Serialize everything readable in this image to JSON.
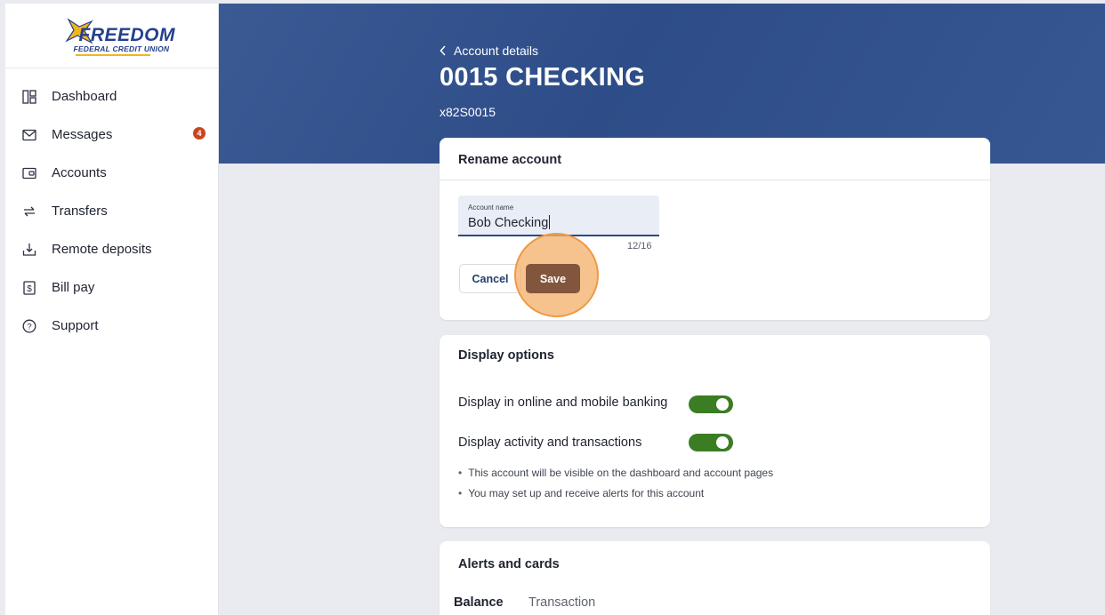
{
  "brand": {
    "name": "FREEDOM",
    "tagline": "FEDERAL CREDIT UNION",
    "primary_color": "#24408e",
    "accent_color": "#f1b51c"
  },
  "sidebar": {
    "items": [
      {
        "label": "Dashboard",
        "icon": "dashboard-icon"
      },
      {
        "label": "Messages",
        "icon": "envelope-icon",
        "badge": "4"
      },
      {
        "label": "Accounts",
        "icon": "wallet-icon"
      },
      {
        "label": "Transfers",
        "icon": "transfer-arrows-icon"
      },
      {
        "label": "Remote deposits",
        "icon": "download-tray-icon"
      },
      {
        "label": "Bill pay",
        "icon": "dollar-receipt-icon"
      },
      {
        "label": "Support",
        "icon": "question-circle-icon"
      }
    ]
  },
  "header": {
    "back_label": "Account details",
    "title": "0015 CHECKING",
    "subtitle": "x82S0015"
  },
  "rename": {
    "title": "Rename account",
    "field_label": "Account name",
    "field_value": "Bob Checking",
    "counter": "12/16",
    "cancel_label": "Cancel",
    "save_label": "Save"
  },
  "display_options": {
    "title": "Display options",
    "toggle1_label": "Display in online and mobile banking",
    "toggle1_on": true,
    "toggle2_label": "Display activity and transactions",
    "toggle2_on": true,
    "bullets": [
      "This account will be visible on the dashboard and account pages",
      "You may set up and receive alerts for this account"
    ]
  },
  "alerts": {
    "title": "Alerts and cards",
    "tab_active": "Balance",
    "tab_inactive": "Transaction"
  }
}
